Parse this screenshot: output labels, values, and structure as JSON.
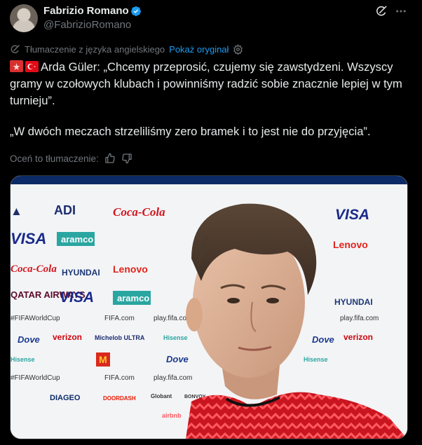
{
  "author": {
    "name": "Fabrizio Romano",
    "handle": "@FabrizioRomano"
  },
  "translation": {
    "label": "Tłumaczenie z języka angielskiego",
    "show_original": "Pokaż oryginał"
  },
  "tweet": {
    "line1": "Arda Güler: „Chcemy przeprosić, czujemy się zawstydzeni. Wszyscy gramy w czołowych klubach i powinniśmy radzić sobie znacznie lepiej w tym turnieju”.",
    "line2": "„W dwóch meczach strzeliliśmy zero bramek i to jest nie do przyjęcia”."
  },
  "rate": {
    "label": "Oceń to tłumaczenie:"
  },
  "media": {
    "logos": [
      "ADI",
      "Coca-Cola",
      "VISA",
      "aramco",
      "Lenovo",
      "HYUNDAI",
      "#FIFAWorldCup",
      "FIFA.com",
      "play.fifa.com",
      "verizon",
      "Dove",
      "Michelob ULTRA",
      "Hisense",
      "DIAGEO",
      "Globant",
      "DOORDASH",
      "BONVOY",
      "airbnb",
      "QATAR AIRWAYS"
    ]
  },
  "colors": {
    "accent": "#1d9bf0",
    "muted": "#71767b",
    "text": "#e7e9ea",
    "background": "#000000",
    "verified": "#1d9bf0"
  },
  "icons": [
    "verified-badge-icon",
    "grok-icon",
    "more-icon",
    "translate-icon",
    "settings-icon",
    "thumbs-up-icon",
    "thumbs-down-icon",
    "siren-emoji-icon",
    "turkey-flag-icon"
  ]
}
